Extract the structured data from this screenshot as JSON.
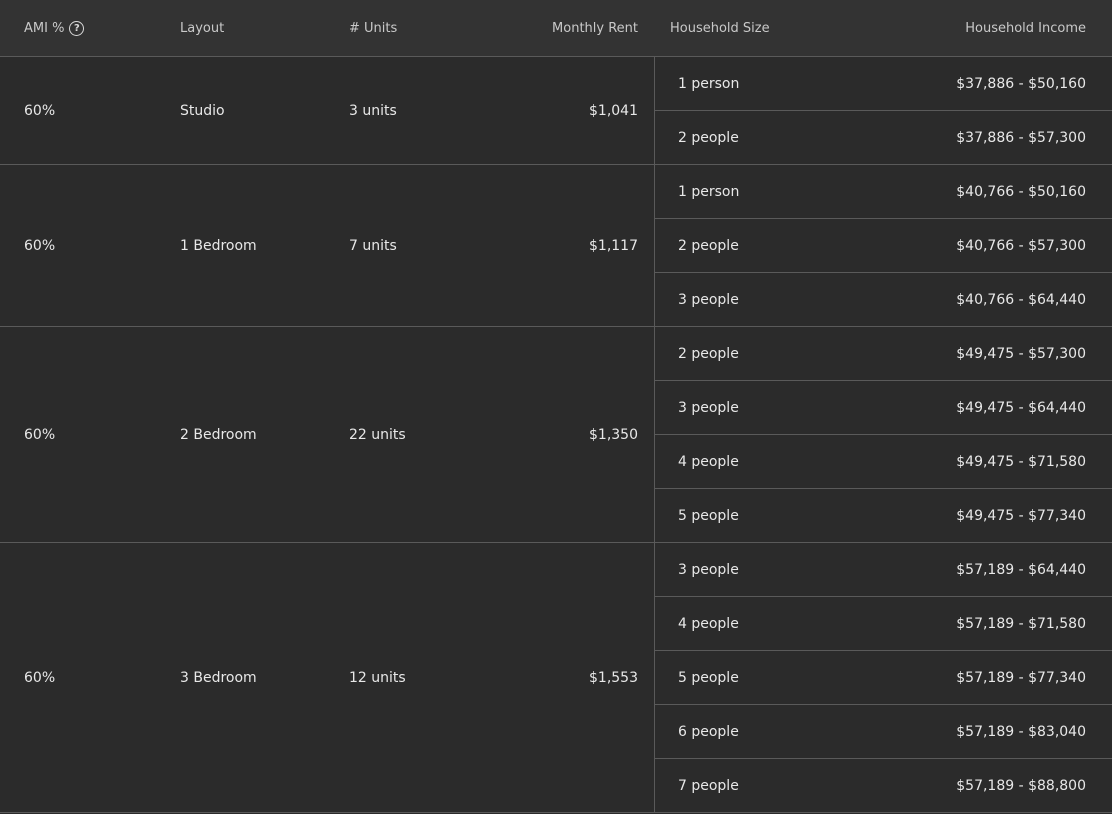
{
  "headers": {
    "ami": "AMI %",
    "help_icon": "?",
    "layout": "Layout",
    "units": "# Units",
    "rent": "Monthly Rent",
    "household_size": "Household Size",
    "household_income": "Household Income"
  },
  "rows": [
    {
      "ami": "60%",
      "layout": "Studio",
      "units": "3 units",
      "rent": "$1,041",
      "households": [
        {
          "size": "1 person",
          "income": "$37,886 - $50,160"
        },
        {
          "size": "2 people",
          "income": "$37,886 - $57,300"
        }
      ]
    },
    {
      "ami": "60%",
      "layout": "1 Bedroom",
      "units": "7 units",
      "rent": "$1,117",
      "households": [
        {
          "size": "1 person",
          "income": "$40,766 - $50,160"
        },
        {
          "size": "2 people",
          "income": "$40,766 - $57,300"
        },
        {
          "size": "3 people",
          "income": "$40,766 - $64,440"
        }
      ]
    },
    {
      "ami": "60%",
      "layout": "2 Bedroom",
      "units": "22 units",
      "rent": "$1,350",
      "households": [
        {
          "size": "2 people",
          "income": "$49,475 - $57,300"
        },
        {
          "size": "3 people",
          "income": "$49,475 - $64,440"
        },
        {
          "size": "4 people",
          "income": "$49,475 - $71,580"
        },
        {
          "size": "5 people",
          "income": "$49,475 - $77,340"
        }
      ]
    },
    {
      "ami": "60%",
      "layout": "3 Bedroom",
      "units": "12 units",
      "rent": "$1,553",
      "households": [
        {
          "size": "3 people",
          "income": "$57,189 - $64,440"
        },
        {
          "size": "4 people",
          "income": "$57,189 - $71,580"
        },
        {
          "size": "5 people",
          "income": "$57,189 - $77,340"
        },
        {
          "size": "6 people",
          "income": "$57,189 - $83,040"
        },
        {
          "size": "7 people",
          "income": "$57,189 - $88,800"
        }
      ]
    }
  ]
}
